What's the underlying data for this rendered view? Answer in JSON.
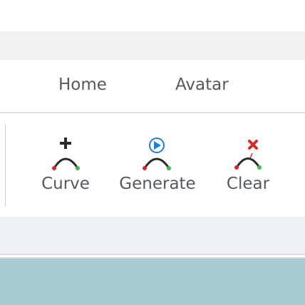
{
  "tabs": [
    {
      "label": "Home"
    },
    {
      "label": "Avatar"
    }
  ],
  "tools": [
    {
      "label": "Curve",
      "icon": "curve-add-icon"
    },
    {
      "label": "Generate",
      "icon": "curve-generate-icon"
    },
    {
      "label": "Clear",
      "icon": "curve-clear-icon"
    }
  ],
  "colors": {
    "curve_stroke": "#2b2b2b",
    "start_point": "#e0262b",
    "end_point": "#3dbb4a",
    "generate_accent": "#1c7ee0",
    "clear_accent": "#d42a2a",
    "canvas": "#a7cbd2"
  }
}
